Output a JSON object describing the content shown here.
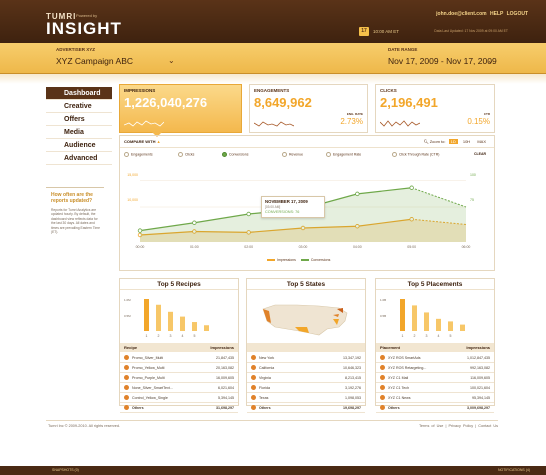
{
  "app": {
    "logo_small": "TUMRI",
    "logo_big": "INSIGHT",
    "powered": "Powered by"
  },
  "header": {
    "user": "john.doe@client.com",
    "help": "HELP",
    "logout": "LOGOUT",
    "calendar_day": "17",
    "clock": "10:00 AM ET",
    "updated": "Data Last Updated: 17 Nov 2009 at 09:00 AM ET"
  },
  "selectors": {
    "advertiser_label": "ADVERTISER XYZ",
    "advertiser_value": "XYZ Campaign ABC",
    "date_label": "DATE RANGE",
    "date_value": "Nov 17, 2009  -  Nov 17, 2009"
  },
  "nav": {
    "items": [
      "Dashboard",
      "Creative",
      "Offers",
      "Media",
      "Audience",
      "Advanced"
    ],
    "active": "Dashboard"
  },
  "help": {
    "question": "How often are the reports updated?",
    "text": "Reports for Tumri Analytics are updated hourly. By default, the dashboard view reflects data for the last 30 days. All dates and times are prevailing Eastern Time (ET)."
  },
  "kpis": [
    {
      "label": "IMPRESSIONS",
      "value": "1,226,040,276",
      "side_label": "",
      "side_value": ""
    },
    {
      "label": "ENGAGEMENTS",
      "value": "8,649,962",
      "side_label": "ENG. RATE",
      "side_value": "2.73%"
    },
    {
      "label": "CLICKS",
      "value": "2,196,491",
      "side_label": "CTR",
      "side_value": "0.15%"
    }
  ],
  "chart_controls": {
    "compare": "COMPARE WITH",
    "zoom_label": "Zoom to:",
    "zoom_options": [
      "1D",
      "10H",
      "MAX"
    ],
    "zoom_active": "1D",
    "metrics": [
      "Engagements",
      "Clicks",
      "Conversions",
      "Revenue",
      "Engagement Rate",
      "Click Through Rate (CTR)"
    ],
    "metric_active": "Conversions",
    "clear": "CLEAR"
  },
  "chart_data": {
    "type": "line",
    "x": [
      "00:00",
      "01:00",
      "02:00",
      "03:00",
      "04:00",
      "05:00",
      "06:00"
    ],
    "series": [
      {
        "name": "Impressions",
        "values": [
          8,
          12,
          11,
          16,
          18,
          26,
          20
        ],
        "color": "#f2a62a"
      },
      {
        "name": "Conversions",
        "values": [
          13,
          22,
          32,
          38,
          55,
          62,
          40
        ],
        "color": "#6fa84a"
      }
    ],
    "left_ticks": [
      "15,000",
      "10,000"
    ],
    "right_ticks": [
      "100",
      "75"
    ],
    "ylim": [
      0,
      80
    ],
    "tooltip": {
      "date": "NOVEMBER 17, 2009",
      "time": "[03:00 AM]",
      "conversions": "CONVERSIONS: 76"
    }
  },
  "top5": [
    {
      "title": "Top 5 Recipes",
      "col1": "Recipe",
      "col2": "Impressions",
      "rows": [
        {
          "name": "Promo_Silver_Multi",
          "value": "21,847,435"
        },
        {
          "name": "Promo_Yellow_Multi",
          "value": "20,163,082"
        },
        {
          "name": "Promo_Purple_Multi",
          "value": "16,009,605"
        },
        {
          "name": "None_Silver_SmartText...",
          "value": "6,021,604"
        },
        {
          "name": "Control_Yellow_Single",
          "value": "5,394,145"
        },
        {
          "name": "Others",
          "value": "31,698,297"
        }
      ],
      "bars": [
        100,
        82,
        60,
        45,
        28,
        18
      ],
      "bar_ticks": [
        "1.0M",
        "0.5M"
      ],
      "bar_labels": [
        "1",
        "2",
        "3",
        "4",
        "5"
      ]
    },
    {
      "title": "Top 5 States",
      "col1": "",
      "col2": "",
      "rows": [
        {
          "name": "New York",
          "value": "13,347,192"
        },
        {
          "name": "California",
          "value": "10,646,323"
        },
        {
          "name": "Virginia",
          "value": "8,213,415"
        },
        {
          "name": "Florida",
          "value": "3,192,276"
        },
        {
          "name": "Texas",
          "value": "1,098,053"
        },
        {
          "name": "Others",
          "value": "19,698,297"
        }
      ]
    },
    {
      "title": "Top 5 Placements",
      "col1": "Placement",
      "col2": "Impressions",
      "rows": [
        {
          "name": "XYZ ROS SmartAds",
          "value": "1,012,847,435"
        },
        {
          "name": "XYZ ROS Retargeting...",
          "value": "992,163,082"
        },
        {
          "name": "XYZ C1 Mail",
          "value": "116,009,605"
        },
        {
          "name": "XYZ C1 Tech",
          "value": "100,021,604"
        },
        {
          "name": "XYZ C1 News",
          "value": "95,394,145"
        },
        {
          "name": "Others",
          "value": "3,009,698,297"
        }
      ],
      "bars": [
        100,
        80,
        58,
        38,
        30,
        20
      ],
      "bar_ticks": [
        "1.0B",
        "0.5B"
      ],
      "bar_labels": [
        "1",
        "2",
        "3",
        "4",
        "5"
      ]
    }
  ],
  "footer": {
    "copyright": "Tumri Inc © 2009-2010. All rights reserved.",
    "links": "Terms of Use  |  Privacy Policy  |  Contact Us"
  },
  "bottombar": {
    "left": "SNAPSHOTS (0)",
    "right": "NOTIFICATIONS (4)"
  }
}
